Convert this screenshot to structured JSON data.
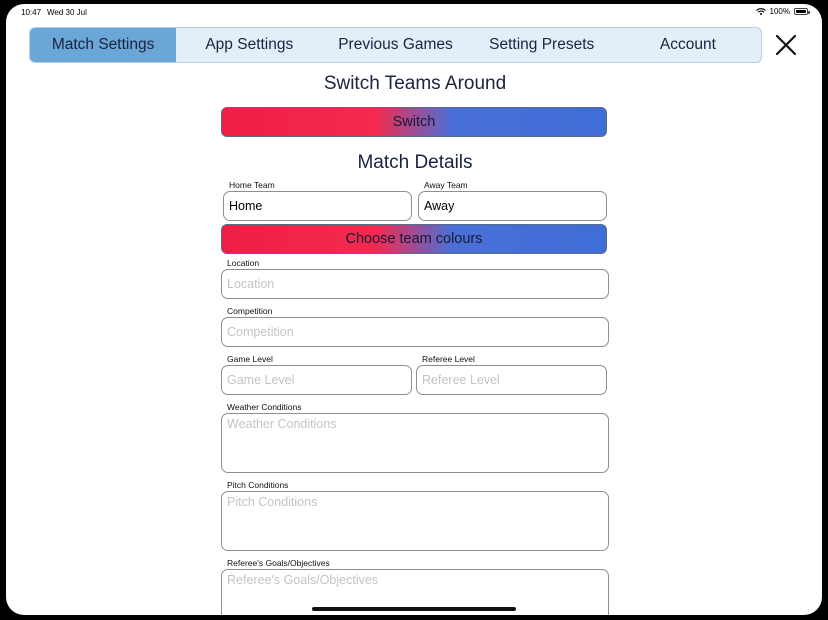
{
  "status": {
    "time": "10:47",
    "date": "Wed 30 Jul",
    "battery": "100%"
  },
  "tabs": [
    {
      "label": "Match Settings",
      "active": true
    },
    {
      "label": "App Settings",
      "active": false
    },
    {
      "label": "Previous Games",
      "active": false
    },
    {
      "label": "Setting Presets",
      "active": false
    },
    {
      "label": "Account",
      "active": false
    }
  ],
  "switch_section": {
    "title": "Switch Teams Around",
    "button_label": "Switch"
  },
  "match_details": {
    "title": "Match Details",
    "home_team": {
      "label": "Home Team",
      "value": "Home"
    },
    "away_team": {
      "label": "Away Team",
      "value": "Away"
    },
    "colours_button": "Choose team colours",
    "location": {
      "label": "Location",
      "placeholder": "Location"
    },
    "competition": {
      "label": "Competition",
      "placeholder": "Competition"
    },
    "game_level": {
      "label": "Game Level",
      "placeholder": "Game Level"
    },
    "referee_level": {
      "label": "Referee Level",
      "placeholder": "Referee Level"
    },
    "weather": {
      "label": "Weather Conditions",
      "placeholder": "Weather Conditions"
    },
    "pitch": {
      "label": "Pitch Conditions",
      "placeholder": "Pitch Conditions"
    },
    "goals": {
      "label": "Referee's Goals/Objectives",
      "placeholder": "Referee's Goals/Objectives"
    }
  },
  "colors": {
    "tab_active": "#6aa6d6",
    "tab_bg": "#e4eef9",
    "gradient_red": "#f01e46",
    "gradient_blue": "#3f6dd6"
  },
  "icons": {
    "close": "close-icon",
    "wifi": "wifi-icon",
    "battery": "battery-icon"
  }
}
